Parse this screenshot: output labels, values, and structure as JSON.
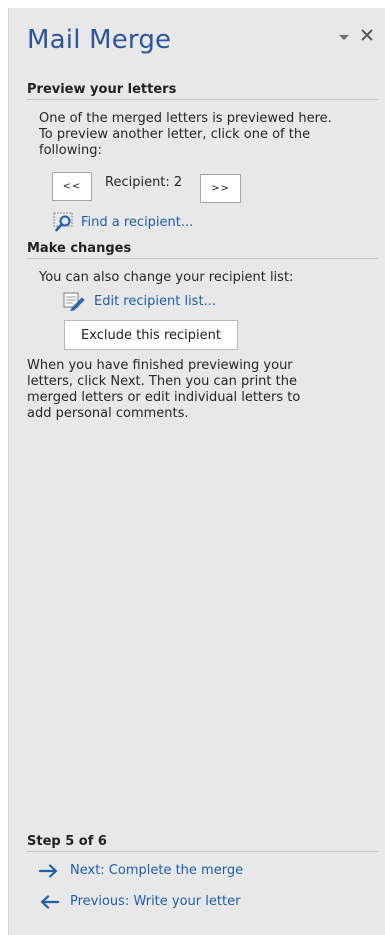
{
  "pane": {
    "title": "Mail Merge",
    "options_icon": "dropdown-triangle-icon",
    "close_icon": "close-icon"
  },
  "preview": {
    "heading": "Preview your letters",
    "description_lines": [
      "One of the merged letters is previewed here.",
      "To preview another letter, click one of the",
      "following:"
    ],
    "prev_label": "<<",
    "recipient_label": "Recipient: 2",
    "next_label": ">>",
    "find_label": "Find a recipient...",
    "find_icon": "magnifier-icon"
  },
  "changes": {
    "heading": "Make changes",
    "description": "You can also change your recipient list:",
    "edit_label": "Edit recipient list...",
    "edit_icon": "edit-list-icon",
    "exclude_label": "Exclude this recipient",
    "finish_lines": [
      "When you have finished previewing your",
      "letters, click Next. Then you can print the",
      "merged letters or edit individual letters to",
      "add personal comments."
    ]
  },
  "steps": {
    "step_label": "Step 5 of 6",
    "next_label": "Next: Complete the merge",
    "previous_label": "Previous: Write your letter",
    "next_icon": "arrow-right-icon",
    "previous_icon": "arrow-left-icon"
  },
  "colors": {
    "accent": "#2b579a",
    "link": "#1f5ea8",
    "background": "#e8e8e8"
  }
}
